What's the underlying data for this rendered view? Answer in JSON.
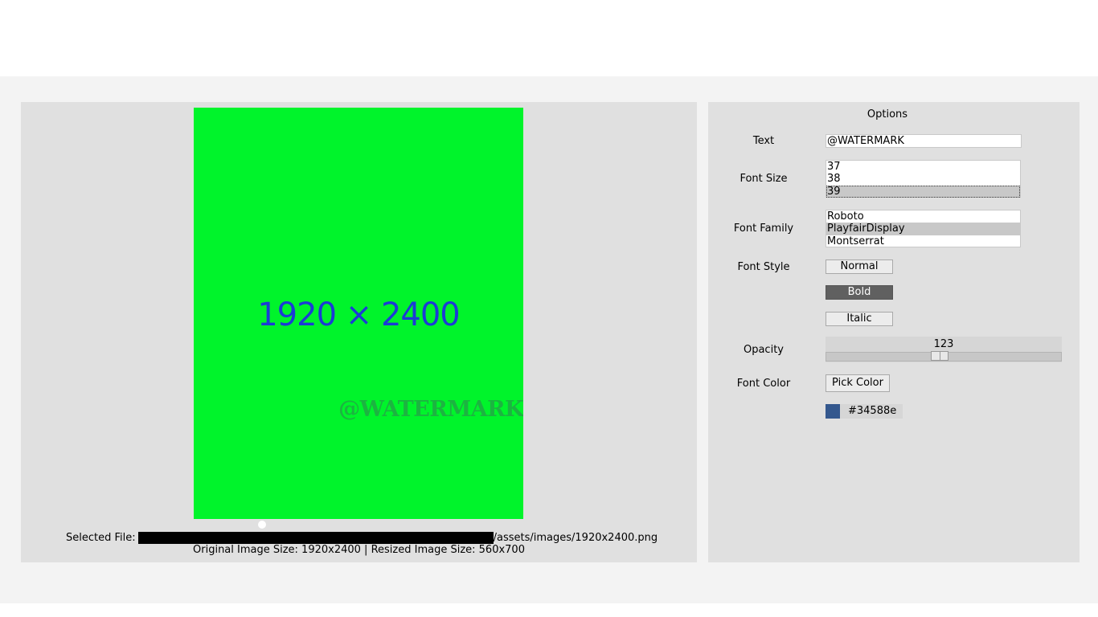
{
  "preview": {
    "dimensions_text": "1920 × 2400",
    "watermark_text": "@WATERMARK",
    "background_color": "#00f42b"
  },
  "file": {
    "selected_label": "Selected File:",
    "path_suffix": "/assets/images/1920x2400.png",
    "size_info": "Original Image Size: 1920x2400 | Resized Image Size: 560x700"
  },
  "options": {
    "title": "Options",
    "text_label": "Text",
    "text_value": "@WATERMARK",
    "font_size_label": "Font Size",
    "font_size_items": [
      "37",
      "38",
      "39"
    ],
    "font_size_selected": "39",
    "font_family_label": "Font Family",
    "font_family_items": [
      "Roboto",
      "PlayfairDisplay",
      "Montserrat"
    ],
    "font_family_selected": "PlayfairDisplay",
    "font_style_label": "Font Style",
    "style_normal": "Normal",
    "style_bold": "Bold",
    "style_italic": "Italic",
    "style_active": "Bold",
    "opacity_label": "Opacity",
    "opacity_value": "123",
    "opacity_max": 255,
    "font_color_label": "Font Color",
    "pick_color_label": "Pick Color",
    "color_hex": "#34588e"
  }
}
